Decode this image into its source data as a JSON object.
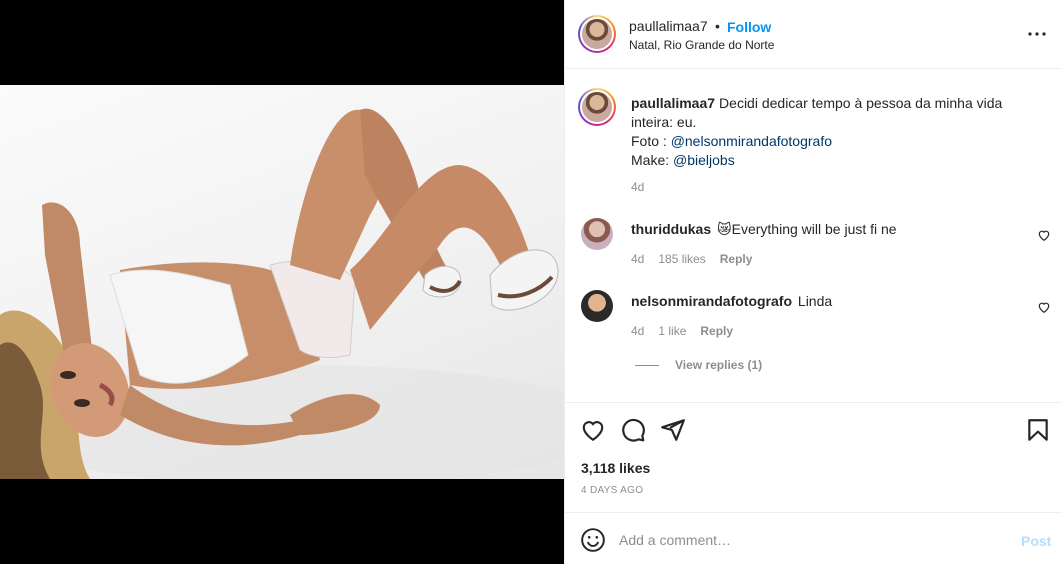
{
  "post": {
    "username": "paullalimaa7",
    "dot": "•",
    "follow_label": "Follow",
    "location": "Natal, Rio Grande do Norte",
    "more_icon": "more-horizontal-icon"
  },
  "caption": {
    "username": "paullalimaa7",
    "line1": "Decidi dedicar tempo à pessoa da minha vida inteira: eu.",
    "photo_prefix": "Foto : ",
    "photo_mention": "@nelsonmirandafotografo",
    "make_prefix": "Make: ",
    "make_mention": "@bieljobs",
    "age": "4d"
  },
  "comments": [
    {
      "username": "thuriddukas",
      "emoji": "😿",
      "text": "Everything will be just fi ne",
      "age": "4d",
      "likes": "185 likes",
      "reply": "Reply"
    },
    {
      "username": "nelsonmirandafotografo",
      "text": "Linda",
      "age": "4d",
      "likes": "1 like",
      "reply": "Reply"
    }
  ],
  "view_replies": "View replies (1)",
  "actions": {
    "likes": "3,118 likes",
    "timestamp": "4 DAYS AGO"
  },
  "add_comment": {
    "placeholder": "Add a comment…",
    "post_label": "Post"
  },
  "colors": {
    "accent": "#0095f6",
    "link": "#00376b",
    "muted": "#8e8e8e",
    "post_disabled": "#b2dffc"
  }
}
